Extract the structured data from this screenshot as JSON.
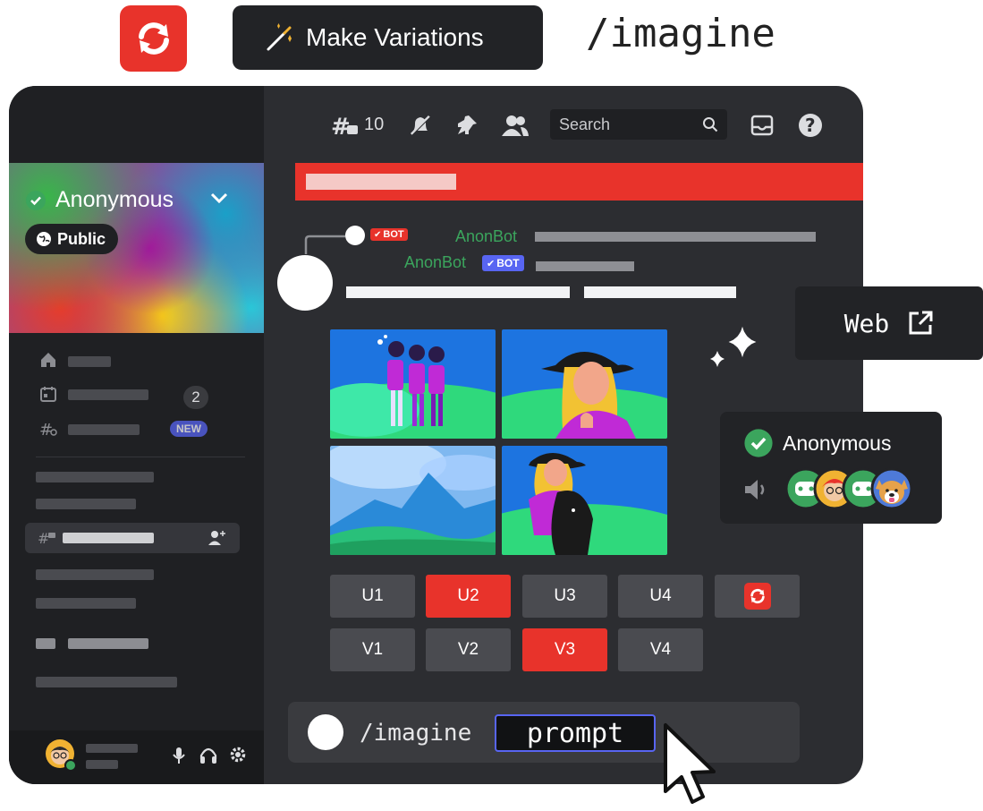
{
  "header": {
    "make_variations_label": "Make Variations",
    "imagine_title": "/imagine"
  },
  "toolbar": {
    "threads_count": "10",
    "search_placeholder": "Search"
  },
  "server": {
    "name": "Anonymous",
    "visibility_label": "Public"
  },
  "sidebar": {
    "events_badge": "2",
    "new_badge": "NEW"
  },
  "messages": [
    {
      "author": "AnonBot",
      "tag": "BOT",
      "tag_color": "#e8332b"
    },
    {
      "author": "AnonBot",
      "tag": "BOT",
      "tag_color": "#5865f2"
    }
  ],
  "upscale_buttons": [
    {
      "label": "U1",
      "active": false
    },
    {
      "label": "U2",
      "active": true
    },
    {
      "label": "U3",
      "active": false
    },
    {
      "label": "U4",
      "active": false
    }
  ],
  "variation_buttons": [
    {
      "label": "V1",
      "active": false
    },
    {
      "label": "V2",
      "active": false
    },
    {
      "label": "V3",
      "active": true
    },
    {
      "label": "V4",
      "active": false
    }
  ],
  "composer": {
    "command": "/imagine",
    "prompt_label": "prompt"
  },
  "web_card": {
    "label": "Web"
  },
  "voice_card": {
    "name": "Anonymous"
  },
  "colors": {
    "accent_red": "#e8332b",
    "blurple": "#5865f2",
    "online_green": "#3ba55d"
  }
}
